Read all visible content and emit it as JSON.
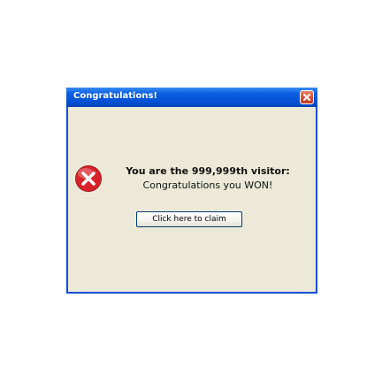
{
  "window": {
    "title": "Congratulations!",
    "close_icon": "close-icon"
  },
  "message": {
    "icon": "error-icon",
    "line1": "You are the 999,999th visitor:",
    "line2": "Congratulations you WON!"
  },
  "button": {
    "label": "Click here to claim"
  },
  "colors": {
    "titlebar": "#0551d8",
    "border": "#0a4fd6",
    "body": "#ece9d8",
    "close": "#d5533b",
    "error": "#d8232a"
  }
}
